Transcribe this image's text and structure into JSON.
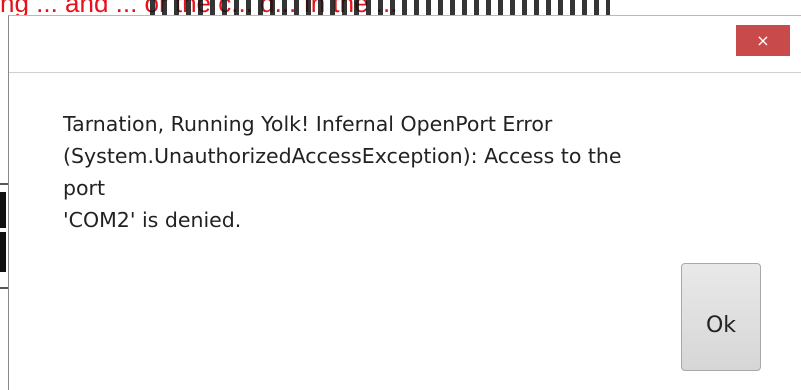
{
  "background": {
    "red_text": "ng ... and ... or the c... d... In the ..."
  },
  "dialog": {
    "close_glyph": "×",
    "message_lines": [
      "Tarnation, Running Yolk! Infernal OpenPort Error",
      "(System.UnauthorizedAccessException): Access to the port",
      "'COM2' is denied."
    ],
    "ok_label": "Ok"
  },
  "colors": {
    "close_button": "#c94a4a",
    "background_red_text": "#e8101a"
  }
}
